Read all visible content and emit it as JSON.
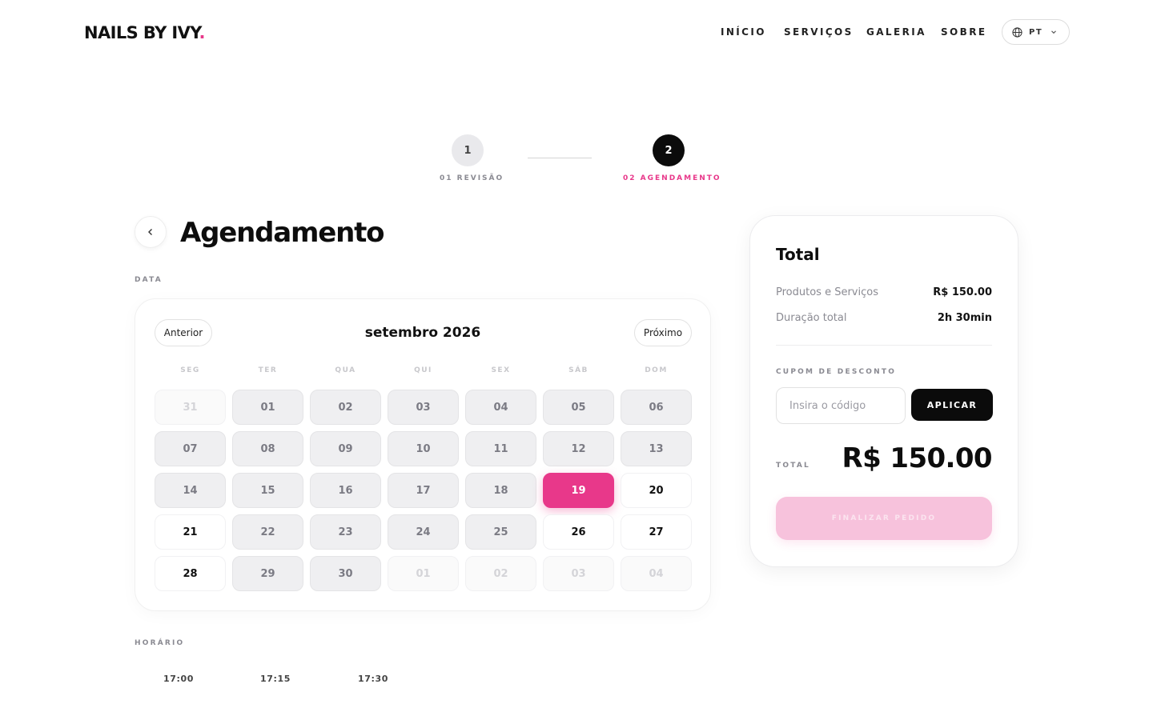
{
  "header": {
    "logo_text": "NAILS BY IVY",
    "logo_dot": ".",
    "nav": [
      "INÍCIO",
      "SERVIÇOS",
      "GALERIA",
      "SOBRE"
    ],
    "language": "PT"
  },
  "stepper": {
    "steps": [
      {
        "number": "1",
        "label": "01 REVISÃO"
      },
      {
        "number": "2",
        "label": "02 AGENDAMENTO"
      }
    ],
    "active_step": 2
  },
  "page": {
    "title": "Agendamento"
  },
  "date_section": {
    "label": "DATA",
    "prev_label": "Anterior",
    "next_label": "Próximo",
    "month": "setembro 2026",
    "weekdays": [
      "SEG",
      "TER",
      "QUA",
      "QUI",
      "SEX",
      "SÁB",
      "DOM"
    ],
    "days": [
      {
        "d": "31",
        "state": "muted"
      },
      {
        "d": "01",
        "state": "unavailable"
      },
      {
        "d": "02",
        "state": "unavailable"
      },
      {
        "d": "03",
        "state": "unavailable"
      },
      {
        "d": "04",
        "state": "unavailable"
      },
      {
        "d": "05",
        "state": "unavailable"
      },
      {
        "d": "06",
        "state": "unavailable"
      },
      {
        "d": "07",
        "state": "unavailable"
      },
      {
        "d": "08",
        "state": "unavailable"
      },
      {
        "d": "09",
        "state": "unavailable"
      },
      {
        "d": "10",
        "state": "unavailable"
      },
      {
        "d": "11",
        "state": "unavailable"
      },
      {
        "d": "12",
        "state": "unavailable"
      },
      {
        "d": "13",
        "state": "unavailable"
      },
      {
        "d": "14",
        "state": "unavailable"
      },
      {
        "d": "15",
        "state": "unavailable"
      },
      {
        "d": "16",
        "state": "unavailable"
      },
      {
        "d": "17",
        "state": "unavailable"
      },
      {
        "d": "18",
        "state": "unavailable"
      },
      {
        "d": "19",
        "state": "selected"
      },
      {
        "d": "20",
        "state": "available"
      },
      {
        "d": "21",
        "state": "available"
      },
      {
        "d": "22",
        "state": "unavailable"
      },
      {
        "d": "23",
        "state": "unavailable"
      },
      {
        "d": "24",
        "state": "unavailable"
      },
      {
        "d": "25",
        "state": "unavailable"
      },
      {
        "d": "26",
        "state": "available"
      },
      {
        "d": "27",
        "state": "available"
      },
      {
        "d": "28",
        "state": "available"
      },
      {
        "d": "29",
        "state": "unavailable"
      },
      {
        "d": "30",
        "state": "unavailable"
      },
      {
        "d": "01",
        "state": "muted"
      },
      {
        "d": "02",
        "state": "muted"
      },
      {
        "d": "03",
        "state": "muted"
      },
      {
        "d": "04",
        "state": "muted"
      }
    ]
  },
  "time_section": {
    "label": "HORÁRIO",
    "times": [
      "17:00",
      "17:15",
      "17:30"
    ]
  },
  "summary": {
    "title": "Total",
    "rows": [
      {
        "label": "Produtos e Serviços",
        "value": "R$ 150.00"
      },
      {
        "label": "Duração total",
        "value": "2h 30min"
      }
    ],
    "coupon_label": "CUPOM DE DESCONTO",
    "coupon_placeholder": "Insira o código",
    "apply_label": "APLICAR",
    "total_label": "TOTAL",
    "total_value": "R$ 150.00",
    "finish_label": "FINALIZAR PEDIDO"
  },
  "colors": {
    "accent": "#e8388a",
    "dark": "#0b0b0b",
    "finish_disabled": "#f7c2dc"
  }
}
